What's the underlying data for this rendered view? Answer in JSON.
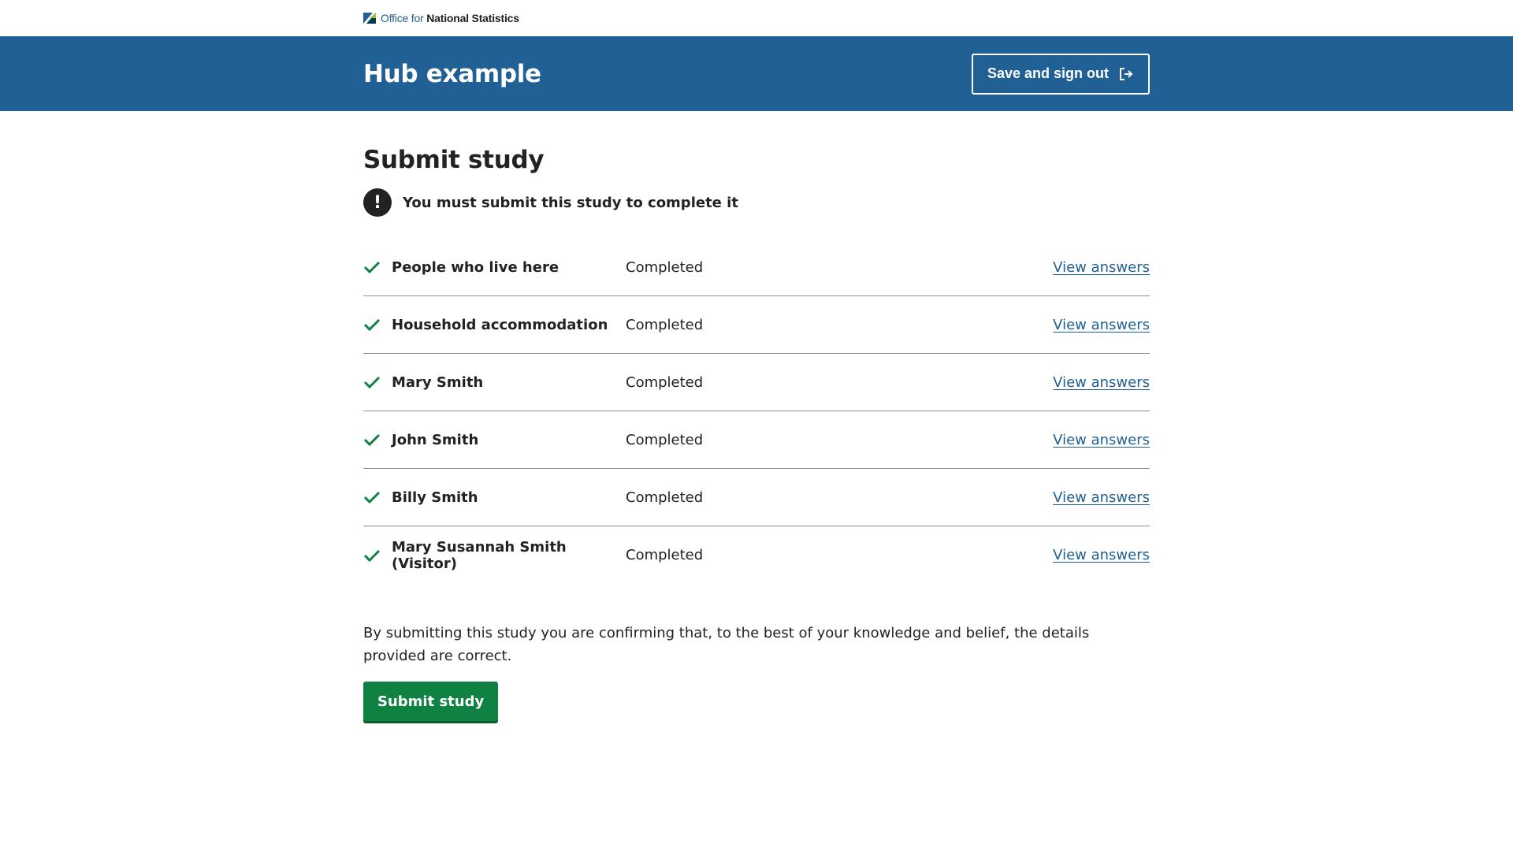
{
  "brand": {
    "prefix": "Office for ",
    "name": "National Statistics",
    "logo_icon": "ons-logo-icon"
  },
  "header": {
    "title": "Hub example",
    "signout_label": "Save and sign out",
    "signout_icon": "exit-icon"
  },
  "main": {
    "title": "Submit study",
    "alert": {
      "icon": "!",
      "text": "You must submit this study to complete it"
    },
    "sections": [
      {
        "title": "People who live here",
        "status": "Completed",
        "link": "View answers"
      },
      {
        "title": "Household accommodation",
        "status": "Completed",
        "link": "View answers"
      },
      {
        "title": "Mary Smith",
        "status": "Completed",
        "link": "View answers"
      },
      {
        "title": "John Smith",
        "status": "Completed",
        "link": "View answers"
      },
      {
        "title": "Billy Smith",
        "status": "Completed",
        "link": "View answers"
      },
      {
        "title": "Mary Susannah Smith (Visitor)",
        "status": "Completed",
        "link": "View answers"
      }
    ],
    "declaration": "By submitting this study you are confirming that, to the best of your knowledge and belief, the details provided are correct.",
    "submit_label": "Submit study"
  },
  "colors": {
    "header_bg": "#206095",
    "link": "#206095",
    "success": "#0f8243",
    "text": "#222222"
  }
}
